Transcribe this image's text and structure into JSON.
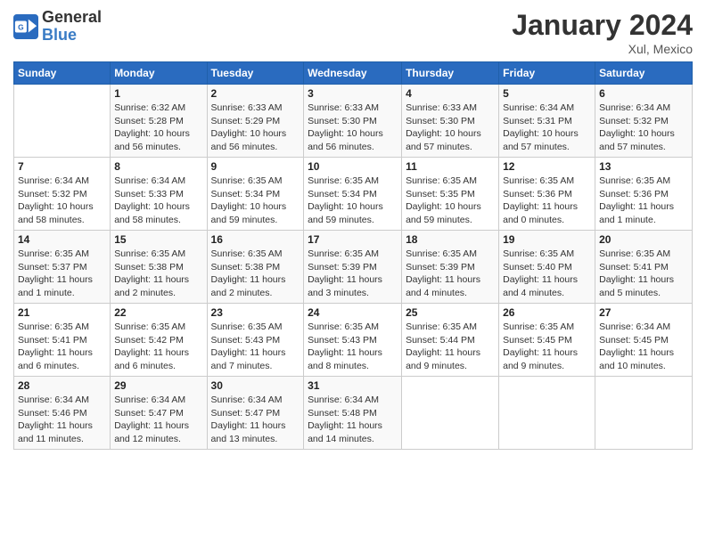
{
  "logo": {
    "line1": "General",
    "line2": "Blue"
  },
  "header": {
    "month": "January 2024",
    "location": "Xul, Mexico"
  },
  "days_of_week": [
    "Sunday",
    "Monday",
    "Tuesday",
    "Wednesday",
    "Thursday",
    "Friday",
    "Saturday"
  ],
  "weeks": [
    [
      {
        "day": "",
        "info": ""
      },
      {
        "day": "1",
        "info": "Sunrise: 6:32 AM\nSunset: 5:28 PM\nDaylight: 10 hours\nand 56 minutes."
      },
      {
        "day": "2",
        "info": "Sunrise: 6:33 AM\nSunset: 5:29 PM\nDaylight: 10 hours\nand 56 minutes."
      },
      {
        "day": "3",
        "info": "Sunrise: 6:33 AM\nSunset: 5:30 PM\nDaylight: 10 hours\nand 56 minutes."
      },
      {
        "day": "4",
        "info": "Sunrise: 6:33 AM\nSunset: 5:30 PM\nDaylight: 10 hours\nand 57 minutes."
      },
      {
        "day": "5",
        "info": "Sunrise: 6:34 AM\nSunset: 5:31 PM\nDaylight: 10 hours\nand 57 minutes."
      },
      {
        "day": "6",
        "info": "Sunrise: 6:34 AM\nSunset: 5:32 PM\nDaylight: 10 hours\nand 57 minutes."
      }
    ],
    [
      {
        "day": "7",
        "info": "Sunrise: 6:34 AM\nSunset: 5:32 PM\nDaylight: 10 hours\nand 58 minutes."
      },
      {
        "day": "8",
        "info": "Sunrise: 6:34 AM\nSunset: 5:33 PM\nDaylight: 10 hours\nand 58 minutes."
      },
      {
        "day": "9",
        "info": "Sunrise: 6:35 AM\nSunset: 5:34 PM\nDaylight: 10 hours\nand 59 minutes."
      },
      {
        "day": "10",
        "info": "Sunrise: 6:35 AM\nSunset: 5:34 PM\nDaylight: 10 hours\nand 59 minutes."
      },
      {
        "day": "11",
        "info": "Sunrise: 6:35 AM\nSunset: 5:35 PM\nDaylight: 10 hours\nand 59 minutes."
      },
      {
        "day": "12",
        "info": "Sunrise: 6:35 AM\nSunset: 5:36 PM\nDaylight: 11 hours\nand 0 minutes."
      },
      {
        "day": "13",
        "info": "Sunrise: 6:35 AM\nSunset: 5:36 PM\nDaylight: 11 hours\nand 1 minute."
      }
    ],
    [
      {
        "day": "14",
        "info": "Sunrise: 6:35 AM\nSunset: 5:37 PM\nDaylight: 11 hours\nand 1 minute."
      },
      {
        "day": "15",
        "info": "Sunrise: 6:35 AM\nSunset: 5:38 PM\nDaylight: 11 hours\nand 2 minutes."
      },
      {
        "day": "16",
        "info": "Sunrise: 6:35 AM\nSunset: 5:38 PM\nDaylight: 11 hours\nand 2 minutes."
      },
      {
        "day": "17",
        "info": "Sunrise: 6:35 AM\nSunset: 5:39 PM\nDaylight: 11 hours\nand 3 minutes."
      },
      {
        "day": "18",
        "info": "Sunrise: 6:35 AM\nSunset: 5:39 PM\nDaylight: 11 hours\nand 4 minutes."
      },
      {
        "day": "19",
        "info": "Sunrise: 6:35 AM\nSunset: 5:40 PM\nDaylight: 11 hours\nand 4 minutes."
      },
      {
        "day": "20",
        "info": "Sunrise: 6:35 AM\nSunset: 5:41 PM\nDaylight: 11 hours\nand 5 minutes."
      }
    ],
    [
      {
        "day": "21",
        "info": "Sunrise: 6:35 AM\nSunset: 5:41 PM\nDaylight: 11 hours\nand 6 minutes."
      },
      {
        "day": "22",
        "info": "Sunrise: 6:35 AM\nSunset: 5:42 PM\nDaylight: 11 hours\nand 6 minutes."
      },
      {
        "day": "23",
        "info": "Sunrise: 6:35 AM\nSunset: 5:43 PM\nDaylight: 11 hours\nand 7 minutes."
      },
      {
        "day": "24",
        "info": "Sunrise: 6:35 AM\nSunset: 5:43 PM\nDaylight: 11 hours\nand 8 minutes."
      },
      {
        "day": "25",
        "info": "Sunrise: 6:35 AM\nSunset: 5:44 PM\nDaylight: 11 hours\nand 9 minutes."
      },
      {
        "day": "26",
        "info": "Sunrise: 6:35 AM\nSunset: 5:45 PM\nDaylight: 11 hours\nand 9 minutes."
      },
      {
        "day": "27",
        "info": "Sunrise: 6:34 AM\nSunset: 5:45 PM\nDaylight: 11 hours\nand 10 minutes."
      }
    ],
    [
      {
        "day": "28",
        "info": "Sunrise: 6:34 AM\nSunset: 5:46 PM\nDaylight: 11 hours\nand 11 minutes."
      },
      {
        "day": "29",
        "info": "Sunrise: 6:34 AM\nSunset: 5:47 PM\nDaylight: 11 hours\nand 12 minutes."
      },
      {
        "day": "30",
        "info": "Sunrise: 6:34 AM\nSunset: 5:47 PM\nDaylight: 11 hours\nand 13 minutes."
      },
      {
        "day": "31",
        "info": "Sunrise: 6:34 AM\nSunset: 5:48 PM\nDaylight: 11 hours\nand 14 minutes."
      },
      {
        "day": "",
        "info": ""
      },
      {
        "day": "",
        "info": ""
      },
      {
        "day": "",
        "info": ""
      }
    ]
  ]
}
